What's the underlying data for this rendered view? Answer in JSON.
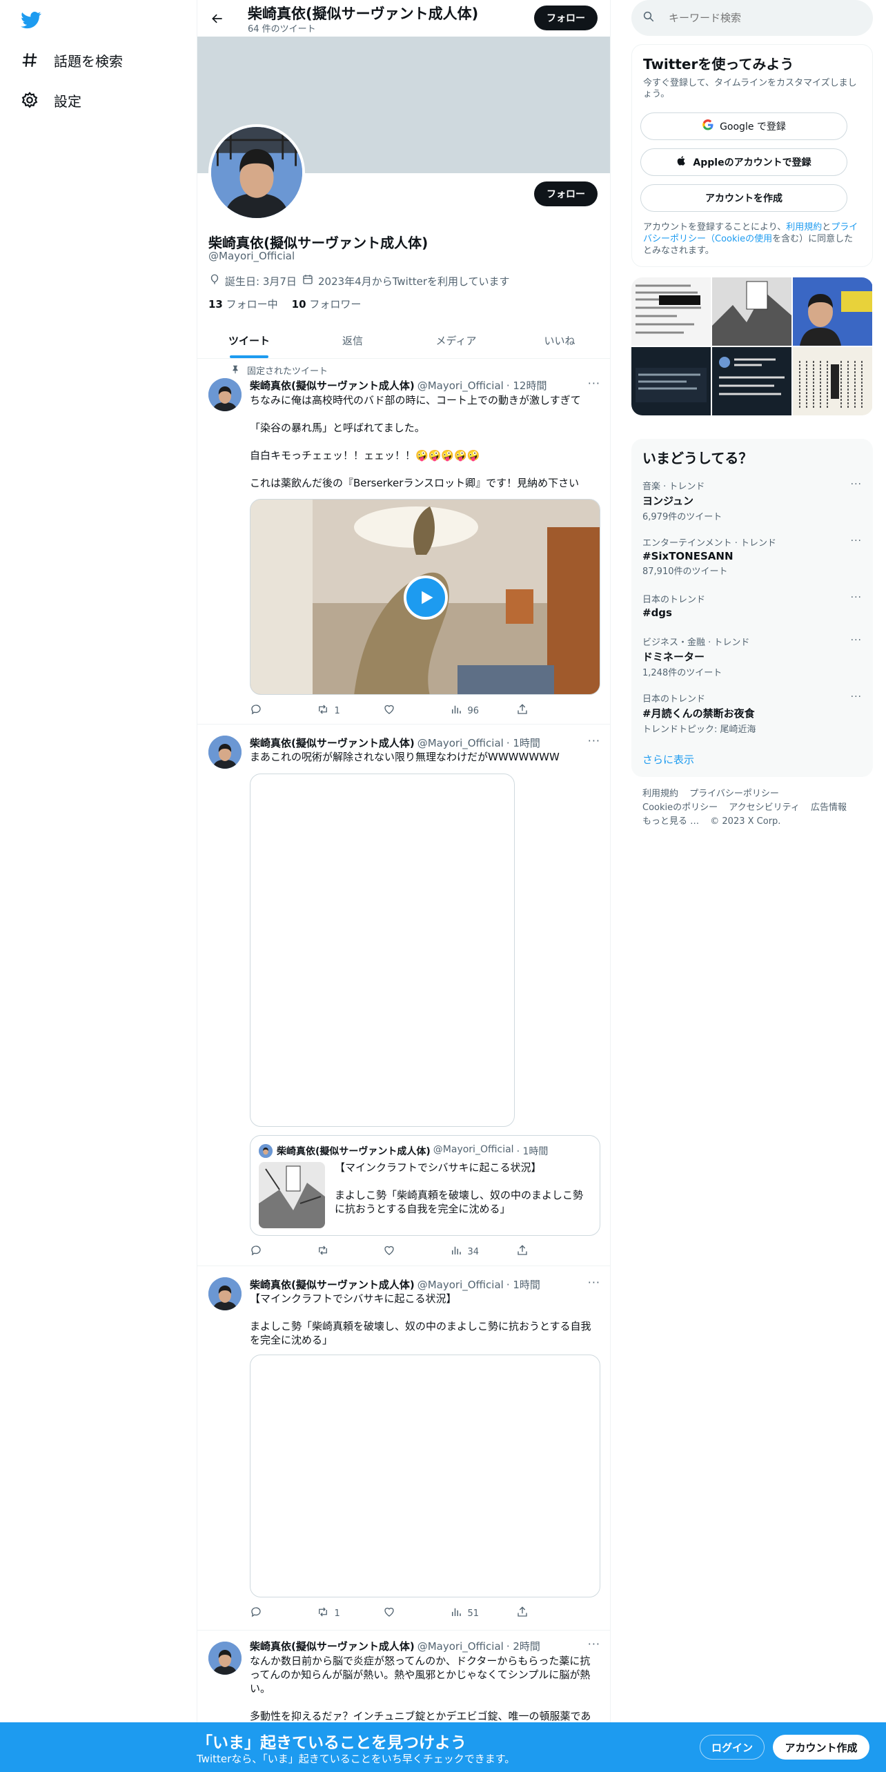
{
  "nav": {
    "items": [
      {
        "label": "話題を検索",
        "icon": "hashtag-icon"
      },
      {
        "label": "設定",
        "icon": "gear-icon"
      }
    ]
  },
  "header": {
    "name": "柴崎真依(擬似サーヴァント成人体)",
    "tweet_count": "64 件のツイート",
    "follow_label": "フォロー"
  },
  "profile": {
    "name": "柴崎真依(擬似サーヴァント成人体)",
    "handle": "@Mayori_Official",
    "follow_label": "フォロー",
    "birthday": "誕生日: 3月7日",
    "joined": "2023年4月からTwitterを利用しています",
    "following_count": "13",
    "following_label": "フォロー中",
    "followers_count": "10",
    "followers_label": "フォロワー"
  },
  "tabs": [
    "ツイート",
    "返信",
    "メディア",
    "いいね"
  ],
  "pinned_label": "固定されたツイート",
  "tweets": [
    {
      "name": "柴崎真依(擬似サーヴァント成人体)",
      "handle": "@Mayori_Official",
      "time": "· 12時間",
      "text": "ちなみに俺は高校時代のバド部の時に、コート上での動きが激しすぎて\n\n「染谷の暴れ馬」と呼ばれてました。\n\n自白キモっチェェッ！！ェェッ！！🤪🤪🤪🤪🤪\n\nこれは薬飲んだ後の『Berserkerランスロット卿』です！見納め下さい",
      "replies": "",
      "retweets": "1",
      "likes": "",
      "views": "96"
    },
    {
      "name": "柴崎真依(擬似サーヴァント成人体)",
      "handle": "@Mayori_Official",
      "time": "· 1時間",
      "text": "まあこれの呪術が解除されない限り無理なわけだがWWWWWWW",
      "replies": "",
      "retweets": "",
      "likes": "",
      "views": "34",
      "quote": {
        "name": "柴崎真依(擬似サーヴァント成人体)",
        "handle": "@Mayori_Official",
        "time": "· 1時間",
        "text": "【マインクラフトでシバサキに起こる状況】\n\nまよしこ勢「柴崎真頼を破壊し、奴の中のまよしこ勢に抗おうとする自我を完全に沈める」"
      }
    },
    {
      "name": "柴崎真依(擬似サーヴァント成人体)",
      "handle": "@Mayori_Official",
      "time": "· 1時間",
      "text": "【マインクラフトでシバサキに起こる状況】\n\nまよしこ勢「柴崎真頼を破壊し、奴の中のまよしこ勢に抗おうとする自我を完全に沈める」",
      "replies": "",
      "retweets": "1",
      "likes": "",
      "views": "51"
    },
    {
      "name": "柴崎真依(擬似サーヴァント成人体)",
      "handle": "@Mayori_Official",
      "time": "· 2時間",
      "text": "なんか数日前から脳で炎症が怒ってんのか、ドクターからもらった薬に抗ってんのか知らんが脳が熱い。熱や風邪とかじゃなくてシンプルに脳が熱い。\n\n多動性を抑えるだァ？インチュニブ錠とかデエビゴ錠、唯一の頓服薬であ"
    }
  ],
  "search": {
    "placeholder": "キーワード検索"
  },
  "signup": {
    "title": "Twitterを使ってみよう",
    "subtitle": "今すぐ登録して、タイムラインをカスタマイズしましょう。",
    "google_label": "Google で登録",
    "apple_label": "Appleのアカウントで登録",
    "create_label": "アカウントを作成",
    "legal_prefix": "アカウントを登録することにより、",
    "terms": "利用規約",
    "and": "と",
    "privacy": "プライバシーポリシー（Cookieの使用",
    "legal_suffix": "を含む）に同意したとみなされます。"
  },
  "trends": {
    "title": "いまどうしてる？",
    "items": [
      {
        "category": "音楽 · トレンド",
        "name": "ヨンジュン",
        "count": "6,979件のツイート"
      },
      {
        "category": "エンターテインメント · トレンド",
        "name": "#SixTONESANN",
        "count": "87,910件のツイート"
      },
      {
        "category": "日本のトレンド",
        "name": "#dgs",
        "count": ""
      },
      {
        "category": "ビジネス・金融 · トレンド",
        "name": "ドミネーター",
        "count": "1,248件のツイート"
      },
      {
        "category": "日本のトレンド",
        "name": "#月読くんの禁断お夜食",
        "count": "トレンドトピック: 尾崎近海"
      }
    ],
    "show_more": "さらに表示"
  },
  "footer": {
    "links": [
      "利用規約",
      "プライバシーポリシー",
      "Cookieのポリシー",
      "アクセシビリティ",
      "広告情報",
      "もっと見る …",
      "© 2023 X Corp."
    ]
  },
  "bottom_bar": {
    "title": "「いま」起きていることを見つけよう",
    "subtitle": "Twitterなら、「いま」起きていることをいち早くチェックできます。",
    "login_label": "ログイン",
    "signup_label": "アカウント作成"
  },
  "colors": {
    "accent": "#1d9bf0",
    "text": "#0f1419",
    "muted": "#536471",
    "banner": "#cfd9de"
  }
}
